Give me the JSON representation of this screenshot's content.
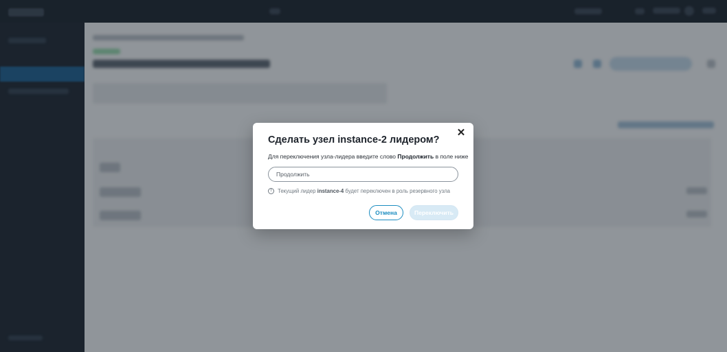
{
  "dialog": {
    "title": "Сделать узел instance-2 лидером?",
    "instruction_prefix": "Для переключения узла-лидера введите слово ",
    "instruction_keyword": "Продолжить",
    "instruction_suffix": " в поле ниже",
    "input_placeholder": "Продолжить",
    "input_value": "",
    "info_prefix": "Текущий лидер ",
    "info_instance": "instance-4",
    "info_suffix": " будет переключен в роль резервного узла",
    "close_icon": "close-icon",
    "info_icon": "info-circle-icon",
    "cancel_label": "Отмена",
    "switch_label": "Переключить"
  },
  "colors": {
    "accent": "#1a8cc0",
    "disabled_button": "#d8eaf5",
    "overlay": "rgba(22,28,36,0.42)",
    "sidebar_active": "#1f5f8f"
  }
}
